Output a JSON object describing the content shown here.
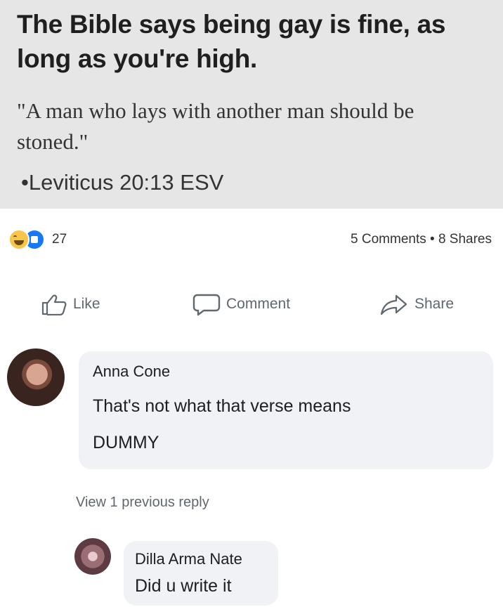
{
  "post": {
    "headline": "The Bible says being gay is fine, as long as you're high.",
    "quote": "\"A man who lays with another man should be stoned.\"",
    "citation": "•Leviticus 20:13 ESV"
  },
  "reactions": {
    "count": "27",
    "comments_shares": "5 Comments • 8 Shares"
  },
  "actions": {
    "like": "Like",
    "comment": "Comment",
    "share": "Share"
  },
  "comments": [
    {
      "author": "Anna Cone",
      "lines": [
        "That's not what that verse means",
        "DUMMY"
      ]
    }
  ],
  "view_previous": "View 1 previous reply",
  "reply": {
    "author": "Dilla Arma Nate",
    "text": "Did u write it"
  },
  "colors": {
    "accent": "#1877f2",
    "bubble": "#f0f2f5",
    "post_background": "#e7e6e6"
  }
}
